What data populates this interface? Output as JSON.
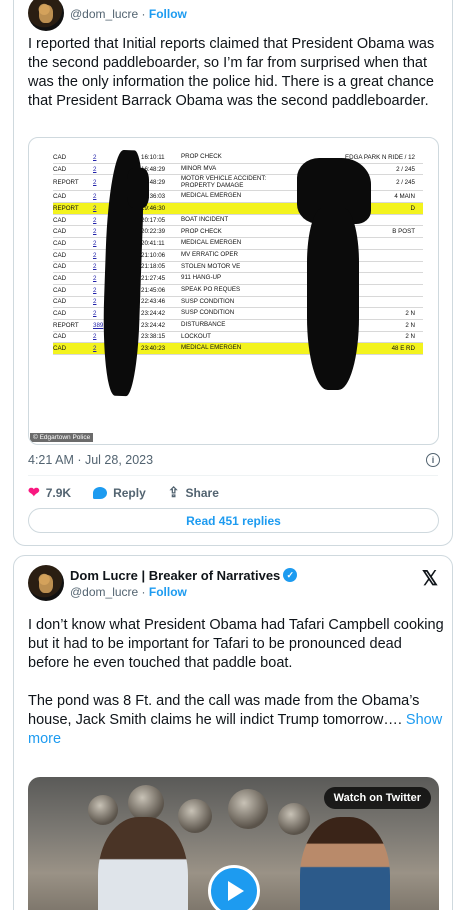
{
  "tweet1": {
    "handle": "@dom_lucre",
    "follow": "Follow",
    "text": "I reported that Initial reports claimed that President Obama was the second paddleboarder, so I’m far from surprised when that was the only information the police hid. There is a great chance that President Barrack Obama was the second paddleboarder.",
    "log_image": {
      "credit": "© Edgartown Police",
      "rows": [
        {
          "type": "CAD",
          "id": "2",
          "time": "16:10:11",
          "desc": "PROP CHECK",
          "loc": "EDGA      PARK N RIDE / 12"
        },
        {
          "type": "CAD",
          "id": "2",
          "time": "16:48:29",
          "desc": "MINOR MVA",
          "loc": "2 / 245"
        },
        {
          "type": "REPORT",
          "id": "2",
          "time": "16:48:29",
          "desc": "MOTOR VEHICLE ACCIDENT: PROPERTY DAMAGE",
          "loc": "2 / 245"
        },
        {
          "type": "CAD",
          "id": "2",
          "time": "18:36:03",
          "desc": "MEDICAL EMERGEN",
          "loc": "4 MAIN"
        },
        {
          "type": "REPORT",
          "id": "2",
          "time": "19:46:30",
          "desc": "",
          "loc": "D"
        },
        {
          "type": "CAD",
          "id": "2",
          "time": "20:17:05",
          "desc": "BOAT INCIDENT",
          "loc": ""
        },
        {
          "type": "CAD",
          "id": "2",
          "time": "20:22:39",
          "desc": "PROP CHECK",
          "loc": "B POST"
        },
        {
          "type": "CAD",
          "id": "2",
          "time": "20:41:11",
          "desc": "MEDICAL EMERGEN",
          "loc": ""
        },
        {
          "type": "CAD",
          "id": "2",
          "time": "21:10:06",
          "desc": "MV ERRATIC OPER",
          "loc": ""
        },
        {
          "type": "CAD",
          "id": "2",
          "time": "21:18:05",
          "desc": "STOLEN MOTOR VE",
          "loc": ""
        },
        {
          "type": "CAD",
          "id": "2",
          "time": "21:27:45",
          "desc": "911 HANG-UP",
          "loc": ""
        },
        {
          "type": "CAD",
          "id": "2",
          "time": "21:45:06",
          "desc": "SPEAK PO REQUES",
          "loc": ""
        },
        {
          "type": "CAD",
          "id": "2",
          "time": "22:43:46",
          "desc": "SUSP CONDITION",
          "loc": ""
        },
        {
          "type": "CAD",
          "id": "2",
          "time": "23:24:42",
          "desc": "SUSP CONDITION",
          "loc": "2            N"
        },
        {
          "type": "REPORT",
          "id": "389",
          "time": "23:24:42",
          "desc": "DISTURBANCE",
          "loc": "2            N"
        },
        {
          "type": "CAD",
          "id": "2",
          "time": "23:38:15",
          "desc": "LOCKOUT",
          "loc": "2            N"
        },
        {
          "type": "CAD",
          "id": "2",
          "time": "23:40:23",
          "desc": "MEDICAL EMERGEN",
          "loc": "48           E RD"
        }
      ]
    },
    "timestamp": "4:21 AM · Jul 28, 2023",
    "likes": "7.9K",
    "reply_label": "Reply",
    "share_label": "Share",
    "read_replies": "Read 451 replies"
  },
  "tweet2": {
    "name": "Dom Lucre | Breaker of Narratives",
    "handle": "@dom_lucre",
    "follow": "Follow",
    "text": "I don’t know what President Obama had Tafari Campbell cooking but it had to be important for Tafari to be pronounced dead before he even touched that paddle boat.\n\nThe pond was 8 Ft. and the call was made from the Obama’s house, Jack Smith claims he will indict Trump tomorrow…. ",
    "show_more": "Show more",
    "watch_label": "Watch on Twitter"
  },
  "colors": {
    "accent": "#1d9bf0",
    "like": "#f91880",
    "highlight": "#f3f31e",
    "text_secondary": "#536471"
  }
}
